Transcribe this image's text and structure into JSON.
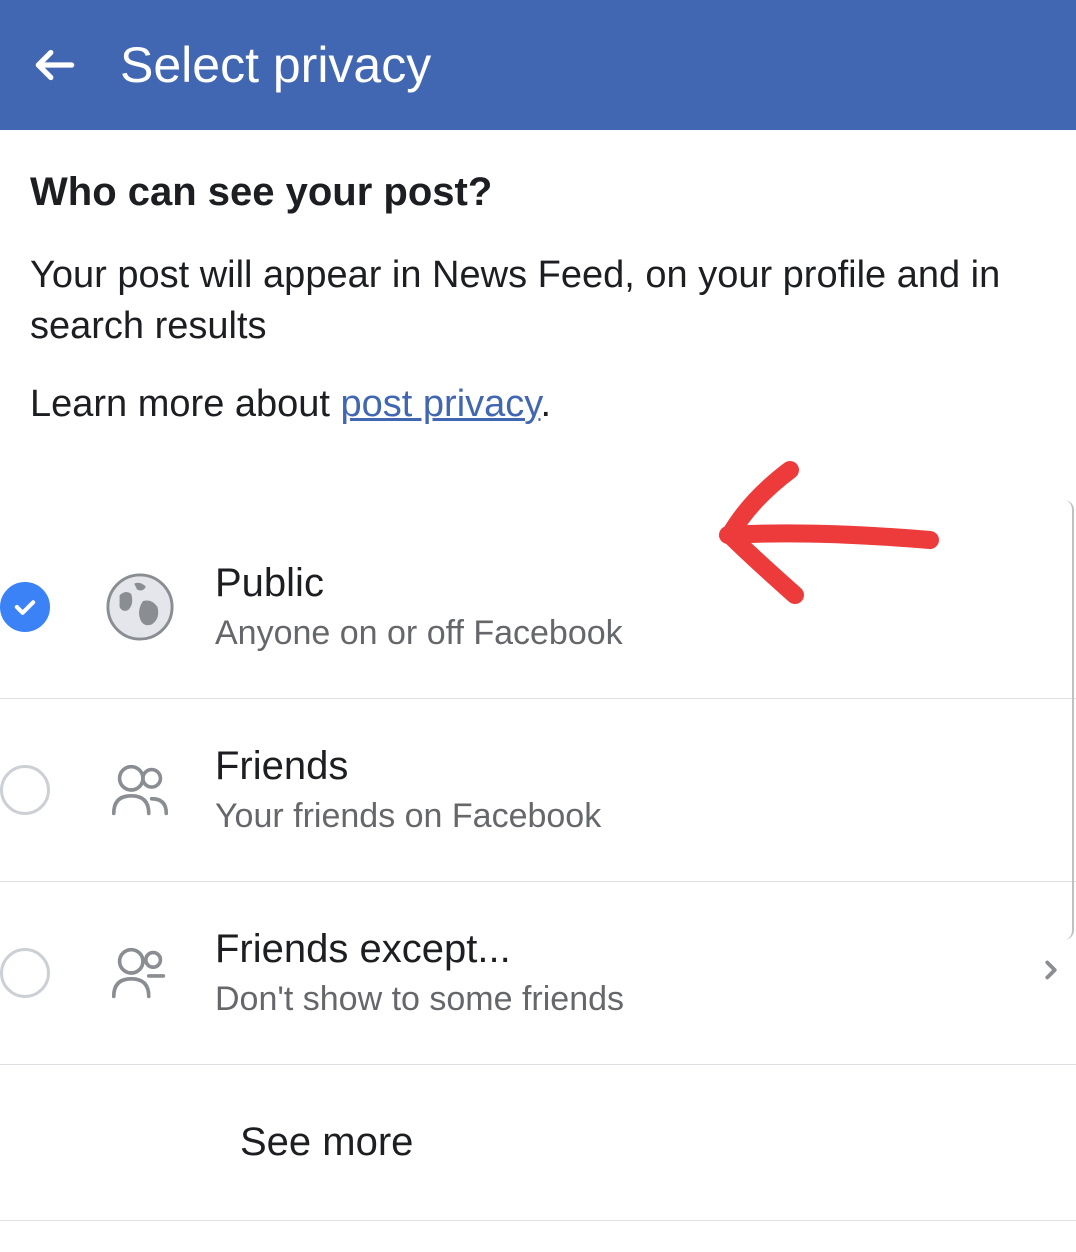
{
  "header": {
    "title": "Select privacy"
  },
  "content": {
    "heading": "Who can see your post?",
    "description": "Your post will appear in News Feed, on your profile and in search results",
    "learn_more_prefix": "Learn more about ",
    "learn_more_link": "post privacy",
    "learn_more_suffix": "."
  },
  "options": [
    {
      "title": "Public",
      "subtitle": "Anyone on or off Facebook",
      "selected": true,
      "icon": "globe-icon",
      "has_chevron": false
    },
    {
      "title": "Friends",
      "subtitle": "Your friends on Facebook",
      "selected": false,
      "icon": "friends-icon",
      "has_chevron": false
    },
    {
      "title": "Friends except...",
      "subtitle": "Don't show to some friends",
      "selected": false,
      "icon": "friends-except-icon",
      "has_chevron": true
    }
  ],
  "see_more": "See more"
}
